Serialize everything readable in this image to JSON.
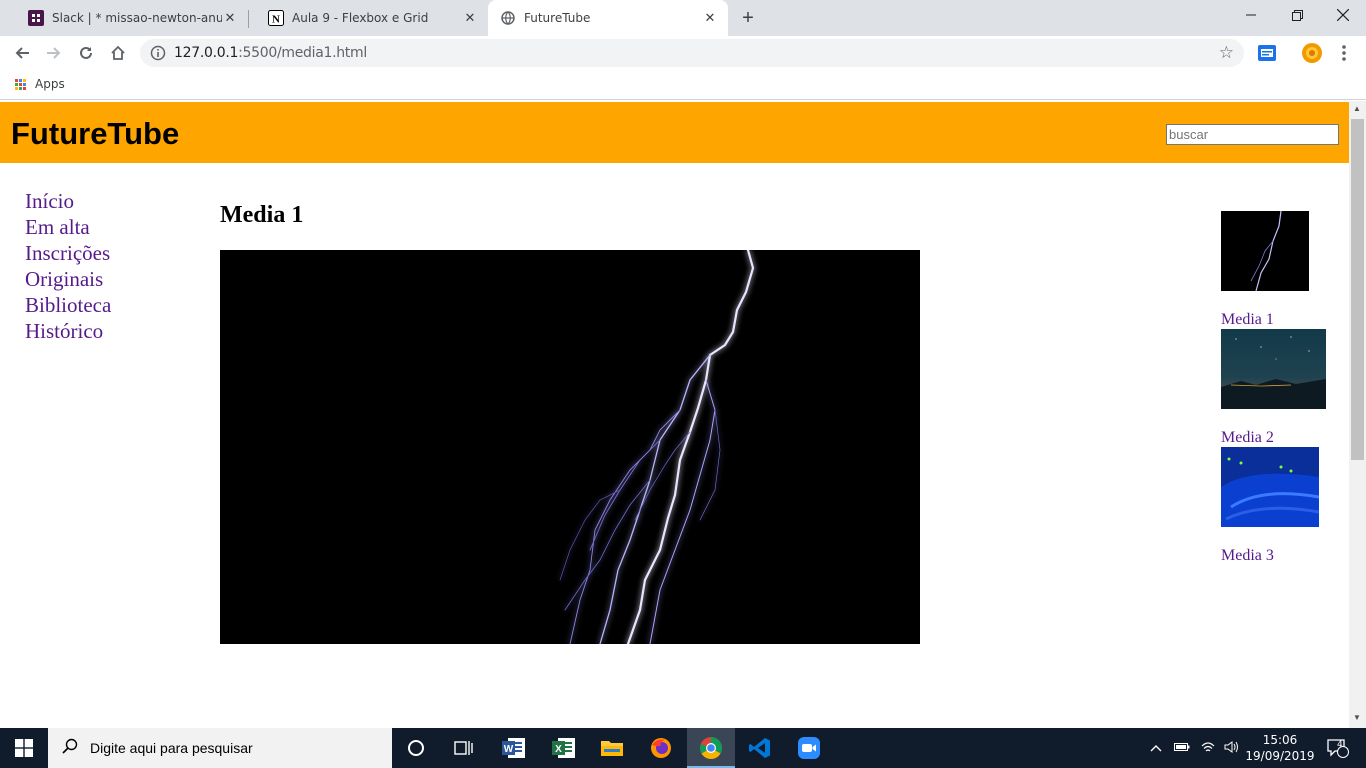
{
  "browser": {
    "tabs": [
      {
        "title": "Slack | * missao-newton-anunciou",
        "icon": "slack-icon",
        "active": false
      },
      {
        "title": "Aula 9 - Flexbox e Grid",
        "icon": "notion-icon",
        "active": false
      },
      {
        "title": "FutureTube",
        "icon": "globe-icon",
        "active": true
      }
    ],
    "url_host": "127.0.0.1",
    "url_path": ":5500/media1.html",
    "bookmarks": {
      "apps_label": "Apps"
    }
  },
  "page": {
    "logo": "FutureTube",
    "search_placeholder": "buscar",
    "nav": [
      "Início",
      "Em alta",
      "Inscrições",
      "Originais",
      "Biblioteca",
      "Histórico"
    ],
    "media_title": "Media 1",
    "sidebar": [
      {
        "label": "Media 1",
        "thumb": "lightning"
      },
      {
        "label": "Media 2",
        "thumb": "night-sky"
      },
      {
        "label": "Media 3",
        "thumb": "network-cables"
      }
    ]
  },
  "taskbar": {
    "search_placeholder": "Digite aqui para pesquisar",
    "time": "15:06",
    "date": "19/09/2019",
    "notifications": "4"
  }
}
